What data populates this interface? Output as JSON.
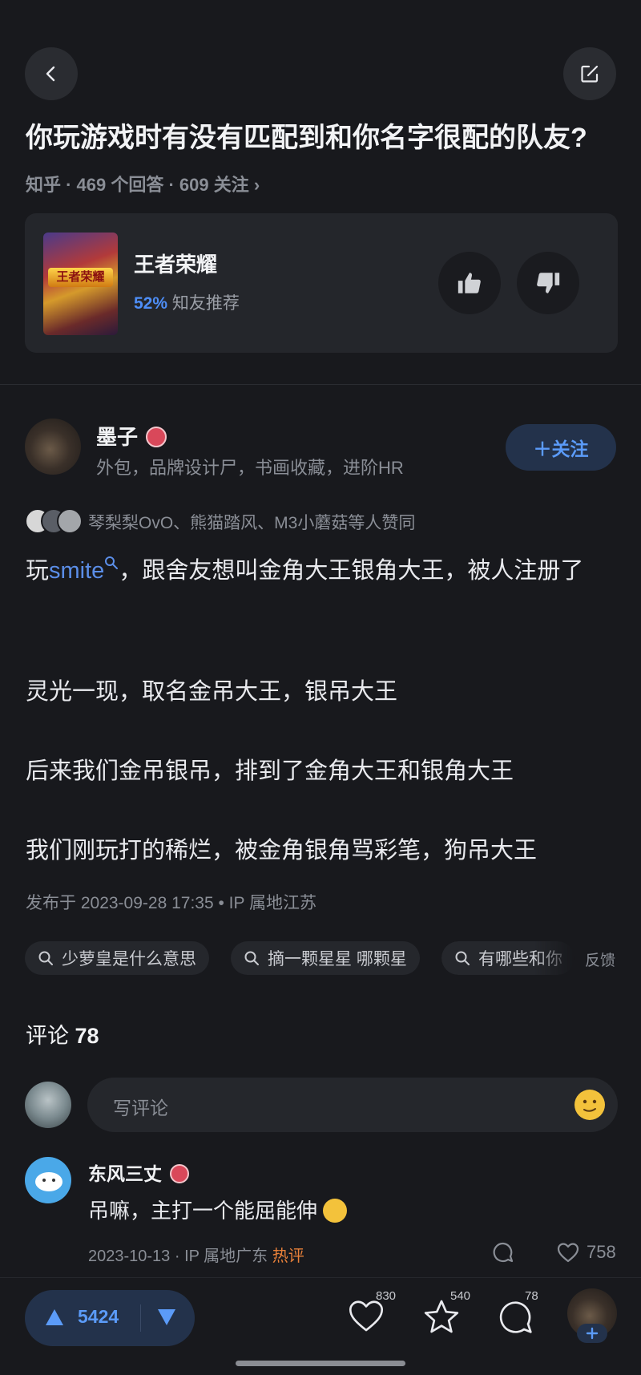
{
  "colors": {
    "background": "#18191d",
    "accent": "#5b9bf8",
    "hot": "#e8813a"
  },
  "header": {
    "back_icon": "chevron-left-icon",
    "edit_icon": "edit-icon"
  },
  "question": {
    "title": "你玩游戏时有没有匹配到和你名字很配的队友?",
    "meta": "知乎 · 469 个回答 · 609 关注 ›"
  },
  "game_card": {
    "logo_text": "王者荣耀",
    "name": "王者荣耀",
    "percent": "52%",
    "recommend_label": "知友推荐"
  },
  "author": {
    "name": "墨子",
    "description": "外包，品牌设计尸，书画收藏，进阶HR",
    "follow_label": "＋关注"
  },
  "liked_by": "琴梨梨OvO、熊猫踏风、M3小蘑菇等人赞同",
  "answer": {
    "p1_prefix": "玩",
    "p1_keyword": "smite",
    "p1_suffix": "，跟舍友想叫金角大王银角大王，被人注册了",
    "p2": "灵光一现，取名金吊大王，银吊大王",
    "p3": "后来我们金吊银吊，排到了金角大王和银角大王",
    "p4": "我们刚玩打的稀烂，被金角银角骂彩笔，狗吊大王"
  },
  "published": "发布于 2023-09-28 17:35 • IP 属地江苏",
  "chips": [
    "少萝皇是什么意思",
    "摘一颗星星 哪颗星",
    "有哪些和你"
  ],
  "feedback_label": "反馈",
  "comments": {
    "header_label": "评论",
    "count": "78",
    "input_placeholder": "写评论",
    "items": [
      {
        "user": "东风三丈",
        "text": "吊嘛，主打一个能屈能伸",
        "date": "2023-10-13 ·",
        "ip": "IP 属地广东",
        "tag": "热评",
        "likes": "758"
      }
    ]
  },
  "bottom_bar": {
    "upvotes": "5424",
    "like_count": "830",
    "favorite_count": "540",
    "comment_count": "78"
  }
}
